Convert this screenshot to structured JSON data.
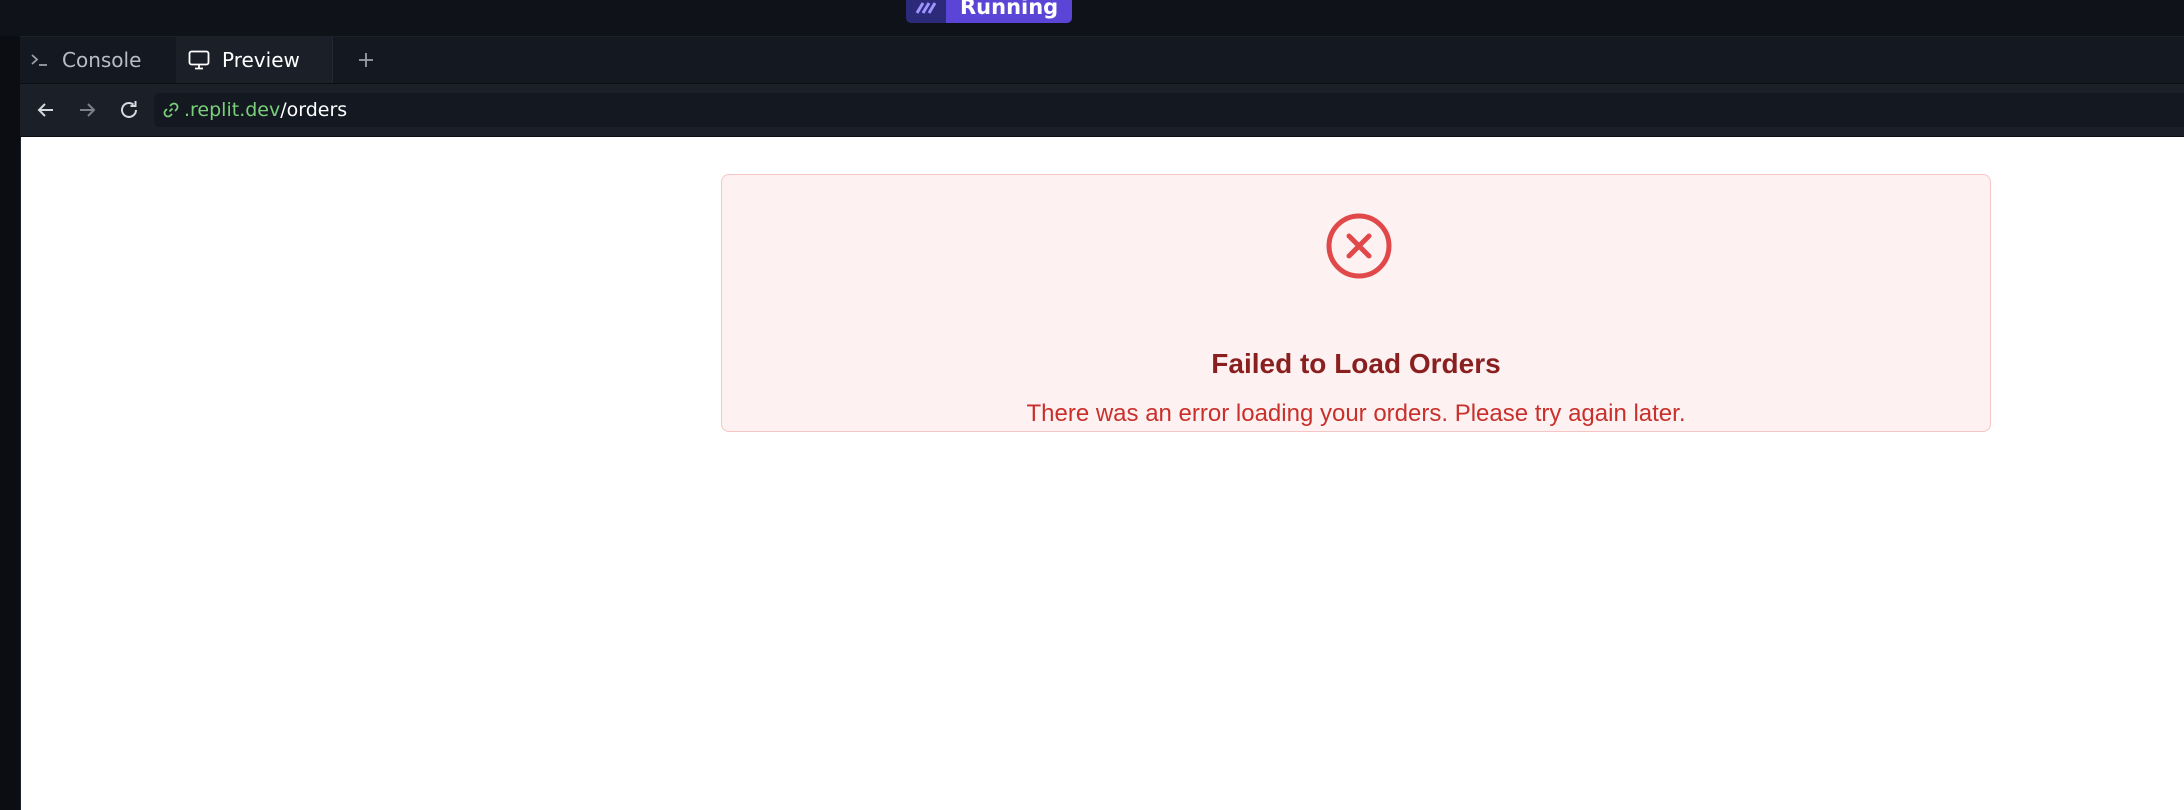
{
  "run_status": {
    "label": "Running"
  },
  "tabs": [
    {
      "label": "Console",
      "icon": "terminal-icon",
      "active": false
    },
    {
      "label": "Preview",
      "icon": "monitor-icon",
      "active": true
    }
  ],
  "address_bar": {
    "host": ".replit.dev",
    "path": "/orders"
  },
  "error": {
    "icon": "x-circle-icon",
    "title": "Failed to Load Orders",
    "message": "There was an error loading your orders. Please try again later."
  },
  "colors": {
    "run_button": "#5b45d6",
    "error_bg": "#fdf1f1",
    "error_border": "#f6c4c4",
    "error_icon": "#e0484a",
    "error_title": "#8a1f1f",
    "error_text": "#c9302c",
    "host_green": "#7ad07a"
  }
}
